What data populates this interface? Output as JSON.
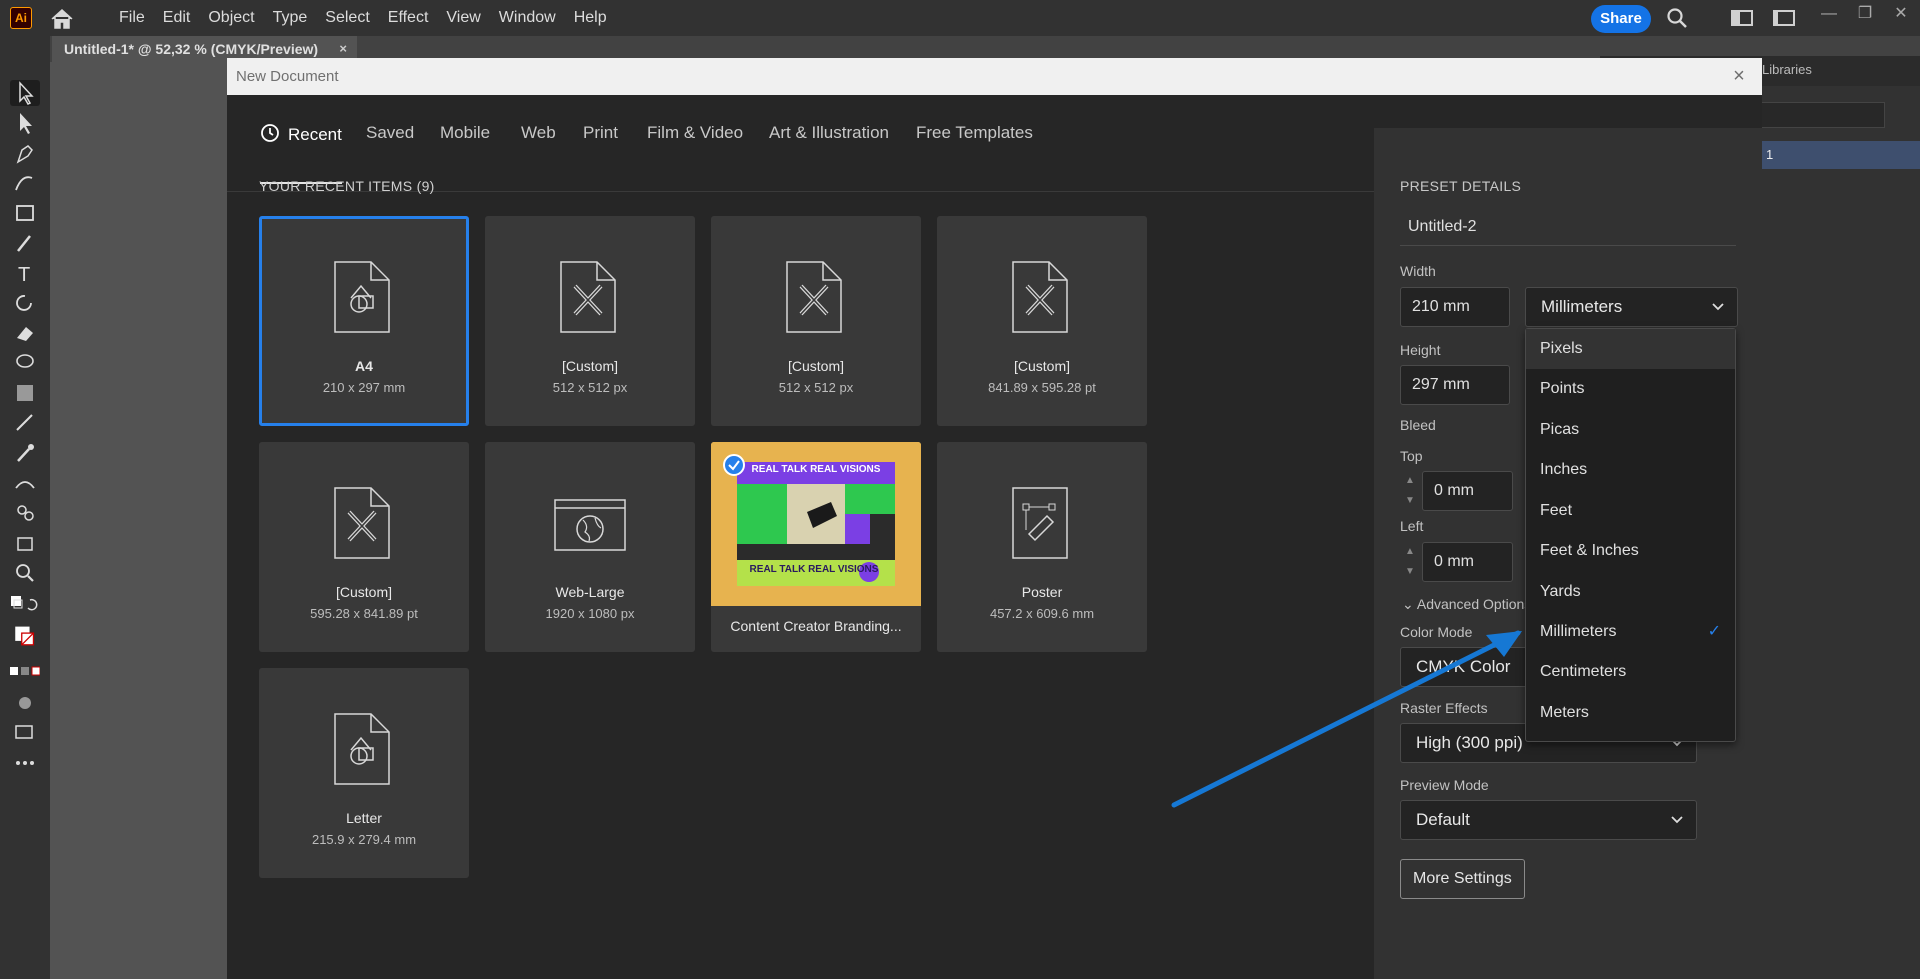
{
  "app": {
    "logo": "Ai"
  },
  "menu": [
    "File",
    "Edit",
    "Object",
    "Type",
    "Select",
    "Effect",
    "View",
    "Window",
    "Help"
  ],
  "topbar": {
    "share_label": "Share"
  },
  "document_tab": {
    "title": "Untitled-1* @ 52,32 % (CMYK/Preview)",
    "close": "×"
  },
  "right_panel": {
    "libraries_label": "Libraries",
    "layer_row": "1"
  },
  "dialog": {
    "title": "New Document",
    "close": "×",
    "tabs": [
      "Recent",
      "Saved",
      "Mobile",
      "Web",
      "Print",
      "Film & Video",
      "Art & Illustration",
      "Free Templates"
    ],
    "recent_heading": "YOUR RECENT ITEMS",
    "recent_count": "(9)",
    "tiles": [
      {
        "name": "A4",
        "size": "210 x 297 mm",
        "icon": "shapes-doc-icon"
      },
      {
        "name": "[Custom]",
        "size": "512 x 512 px",
        "icon": "pencil-ruler-doc-icon"
      },
      {
        "name": "[Custom]",
        "size": "512 x 512 px",
        "icon": "pencil-ruler-doc-icon"
      },
      {
        "name": "[Custom]",
        "size": "841.89 x 595.28 pt",
        "icon": "pencil-ruler-doc-icon"
      },
      {
        "name": "[Custom]",
        "size": "595.28 x 841.89 pt",
        "icon": "pencil-ruler-doc-icon"
      },
      {
        "name": "Web-Large",
        "size": "1920 x 1080 px",
        "icon": "web-globe-icon"
      },
      {
        "name": "Content Creator Branding...",
        "size": "",
        "icon": "template-thumbnail",
        "thumb_text": "REAL TALK REAL VISIONS"
      },
      {
        "name": "Poster",
        "size": "457.2 x 609.6 mm",
        "icon": "poster-pen-icon"
      },
      {
        "name": "Letter",
        "size": "215.9 x 279.4 mm",
        "icon": "shapes-doc-icon"
      }
    ]
  },
  "preset": {
    "heading": "PRESET DETAILS",
    "name": "Untitled-2",
    "width_label": "Width",
    "width_value": "210 mm",
    "units_value": "Millimeters",
    "height_label": "Height",
    "height_value": "297 mm",
    "bleed_label": "Bleed",
    "top_label": "Top",
    "top_value": "0 mm",
    "left_label": "Left",
    "left_value": "0 mm",
    "advanced_label": "Advanced Options",
    "color_mode_label": "Color Mode",
    "color_mode_value": "CMYK Color",
    "raster_label": "Raster Effects",
    "raster_value": "High (300 ppi)",
    "preview_label": "Preview Mode",
    "preview_value": "Default",
    "more_settings": "More Settings"
  },
  "units_dropdown": {
    "options": [
      "Pixels",
      "Points",
      "Picas",
      "Inches",
      "Feet",
      "Feet & Inches",
      "Yards",
      "Millimeters",
      "Centimeters",
      "Meters"
    ],
    "selected": "Millimeters",
    "check": "✓"
  },
  "colors": {
    "accent": "#2680eb",
    "share": "#1473e6",
    "annotation_arrow": "#1678d4"
  }
}
